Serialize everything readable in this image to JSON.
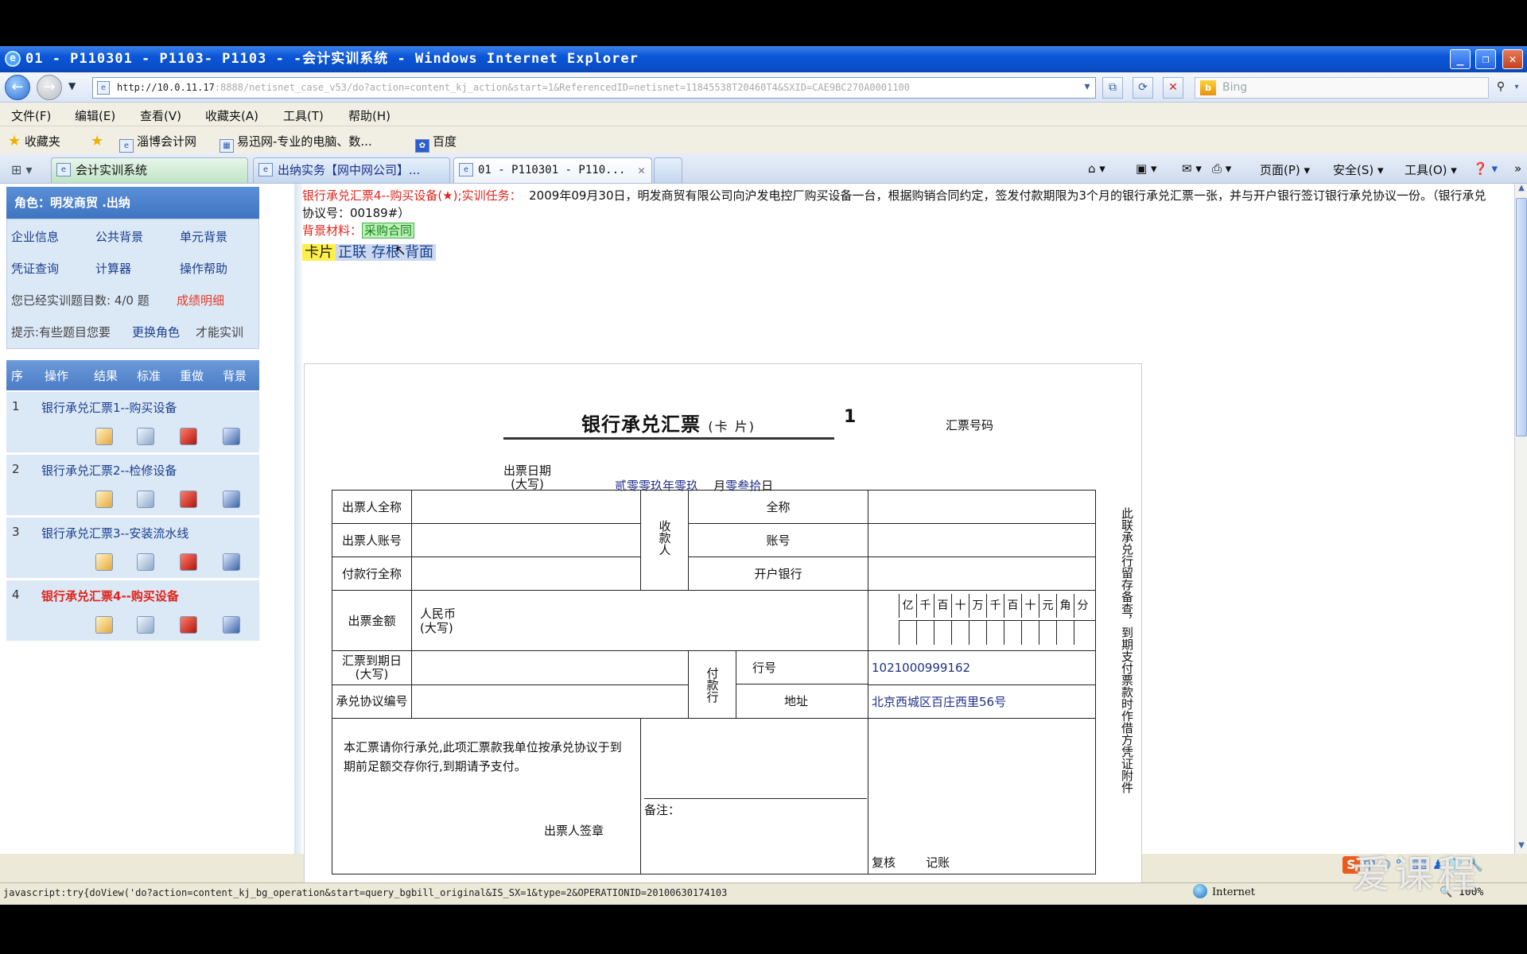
{
  "window": {
    "title": "01 - P110301 - P1103- P1103 - -会计实训系统 - Windows Internet Explorer"
  },
  "address_bar": {
    "url_host": "http://10.0.11.17",
    "url_rest": ":8888/netisnet_case_v53/do?action=content_kj_action&start=1&ReferencedID=netisnet=11845538T20460T4&SXID=CAE9BC270A0001100",
    "search_placeholder": "Bing"
  },
  "menu": [
    "文件(F)",
    "编辑(E)",
    "查看(V)",
    "收藏夹(A)",
    "工具(T)",
    "帮助(H)"
  ],
  "favorites": {
    "label": "收藏夹",
    "items": [
      "淄博会计网",
      "易迅网-专业的电脑、数...",
      "百度"
    ]
  },
  "tabs": [
    {
      "label": "会计实训系统"
    },
    {
      "label": "出纳实务【网中网公司】..."
    },
    {
      "label": "01 - P110301 - P110..."
    }
  ],
  "command_bar": {
    "page": "页面(P)",
    "safety": "安全(S)",
    "tools": "工具(O)"
  },
  "sidebar": {
    "role": "角色：明发商贸 .出纳",
    "grid": [
      [
        "企业信息",
        "公共背景",
        "单元背景"
      ],
      [
        "凭证查询",
        "计算器",
        "操作帮助"
      ]
    ],
    "progress_text": "您已经实训题目数: 4/0 题",
    "score_link": "成绩明细",
    "hint_prefix": "提示:有些题目您要",
    "hint_link": "更换角色",
    "hint_suffix": "才能实训",
    "table_headers": [
      "序",
      "操作",
      "结果",
      "标准",
      "重做",
      "背景"
    ],
    "rows": [
      {
        "num": "1",
        "name": "银行承兑汇票1--购买设备"
      },
      {
        "num": "2",
        "name": "银行承兑汇票2--检修设备"
      },
      {
        "num": "3",
        "name": "银行承兑汇票3--安装流水线"
      },
      {
        "num": "4",
        "name": "银行承兑汇票4--购买设备"
      }
    ]
  },
  "task": {
    "title": "银行承兑汇票4--购买设备(★);",
    "label": "实训任务：",
    "text": "2009年09月30日，明发商贸有限公司向沪发电控厂购买设备一台，根据购销合同约定，签发付款期限为3个月的银行承兑汇票一张，并与开户银行签订银行承兑协议一份。（银行承兑协议号：00189#）",
    "bg_label": "背景材料：",
    "bg_link": "采购合同",
    "view_tabs": [
      "卡片",
      "正联",
      "存根",
      "背面"
    ]
  },
  "bill": {
    "title": "银行承兑汇票",
    "title_sub": "(卡 片)",
    "number": "1",
    "no_label": "汇票号码",
    "date_label": "出票日期",
    "date_label2": "(大写)",
    "date_year": "贰零零玖年零玖",
    "date_month_label": "月",
    "date_day": "零叁拾",
    "date_day_label": "日",
    "drawer_name": "出票人全称",
    "drawer_account": "出票人账号",
    "payer_bank": "付款行全称",
    "payee": "收款人",
    "full_name": "全称",
    "account": "账号",
    "open_bank": "开户银行",
    "amount_label": "出票金额",
    "rmb": "人民币",
    "rmb_sub": "(大写)",
    "digits": [
      "亿",
      "千",
      "百",
      "十",
      "万",
      "千",
      "百",
      "十",
      "元",
      "角",
      "分"
    ],
    "due_date": "汇票到期日",
    "due_date_sub": "(大写)",
    "agreement_no": "承兑协议编号",
    "payer_bank_label": "付款行",
    "bank_no_label": "行号",
    "bank_no": "1021000999162",
    "address_label": "地址",
    "address": "北京西城区百庄西里56号",
    "request_text": "本汇票请你行承兑,此项汇票款我单位按承兑协议于到期前足额交存你行,到期请予支付。",
    "drawer_seal": "出票人签章",
    "remark": "备注：",
    "review": "复核",
    "bookkeep": "记账",
    "side_text": "此联承兑行留存备查，到期支付票款时作借方凭证附件"
  },
  "status": {
    "url": "javascript:try{doView('do?action=content_kj_bg_operation&start=query_bgbill_original&IS_SX=1&type=2&OPERATIONID=20100630174103",
    "zone": "Internet",
    "zoom": "100%"
  },
  "ime": "中",
  "watermark": "爱课程"
}
